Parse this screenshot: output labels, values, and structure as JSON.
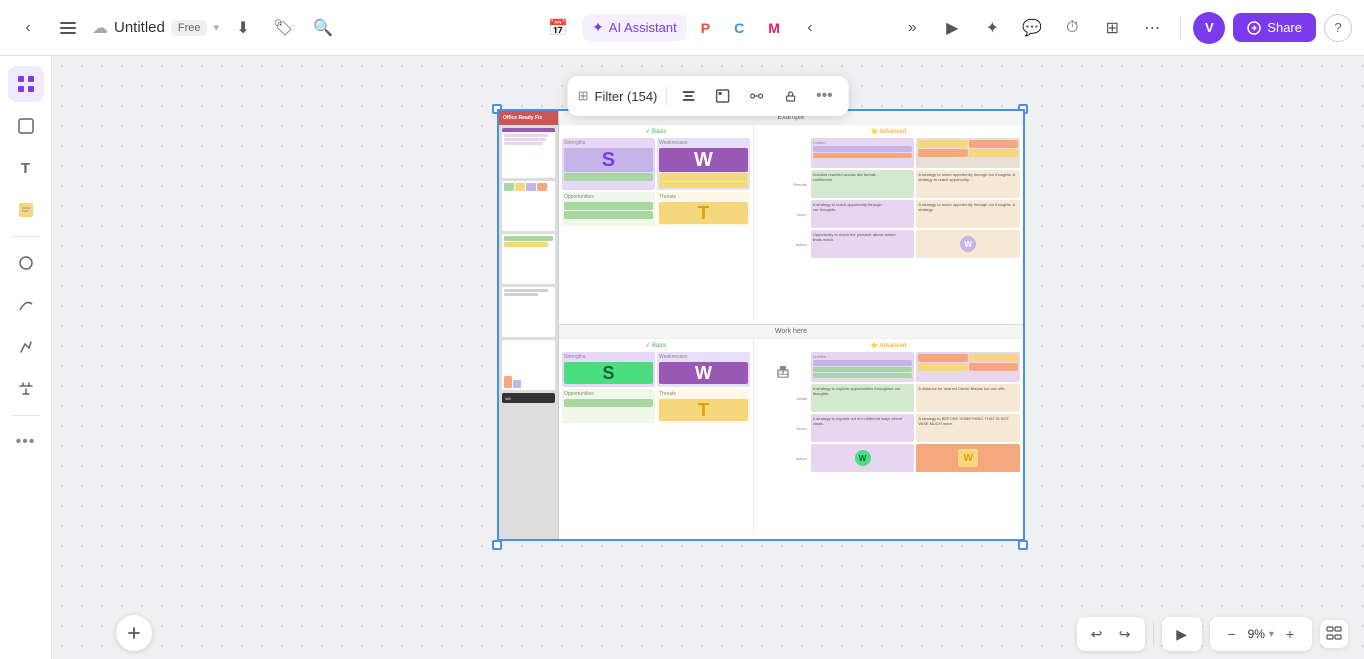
{
  "topbar": {
    "back_label": "‹",
    "menu_label": "☰",
    "title": "Untitled",
    "badge": "Free",
    "download_icon": "⬇",
    "tag_icon": "🏷",
    "search_icon": "🔍",
    "chevron_down": "▾",
    "apps": [
      {
        "label": "AI Assistant",
        "color": "#f5a623",
        "active": false
      },
      {
        "label": "",
        "color": "#e74c3c",
        "active": false
      },
      {
        "label": "",
        "color": "#3498db",
        "active": false
      },
      {
        "label": "",
        "color": "#1abc9c",
        "active": false
      },
      {
        "label": "",
        "color": "#e91e63",
        "active": false
      }
    ],
    "more_icon": "‹",
    "expand_icon": "»",
    "present_icon": "▶",
    "reaction_icon": "✦",
    "comment_icon": "💬",
    "timer_icon": "⏱",
    "dashboard_icon": "⊞",
    "dots_icon": "⋯",
    "avatar": "V",
    "share_label": "Share",
    "help_icon": "?"
  },
  "sidebar": {
    "items": [
      {
        "icon": "◈",
        "label": "frames",
        "active": true
      },
      {
        "icon": "⬜",
        "label": "shapes"
      },
      {
        "icon": "T",
        "label": "text"
      },
      {
        "icon": "🗒",
        "label": "sticky"
      },
      {
        "icon": "◯",
        "label": "objects"
      },
      {
        "icon": "〜",
        "label": "lines"
      },
      {
        "icon": "✏",
        "label": "draw"
      },
      {
        "icon": "✂",
        "label": "tools"
      },
      {
        "icon": "•••",
        "label": "more"
      }
    ]
  },
  "toolbar": {
    "grid_icon": "⊞",
    "filter_label": "Filter (154)",
    "align_icon": "≡",
    "frame_icon": "⬜",
    "connect_icon": "⚡",
    "lock_icon": "🔒",
    "more_icon": "•••"
  },
  "canvas": {
    "zoom": "9%",
    "zoom_dropdown": "▾"
  },
  "content": {
    "top_section_label": "Example",
    "bottom_section_label": "Work here",
    "basic_label": "Basic",
    "advanced_label": "Advanced",
    "swot_labels": [
      "S",
      "W",
      "T"
    ],
    "section_labels": [
      "Strengths",
      "Weaknesses",
      "Opportunities",
      "Threats"
    ]
  }
}
